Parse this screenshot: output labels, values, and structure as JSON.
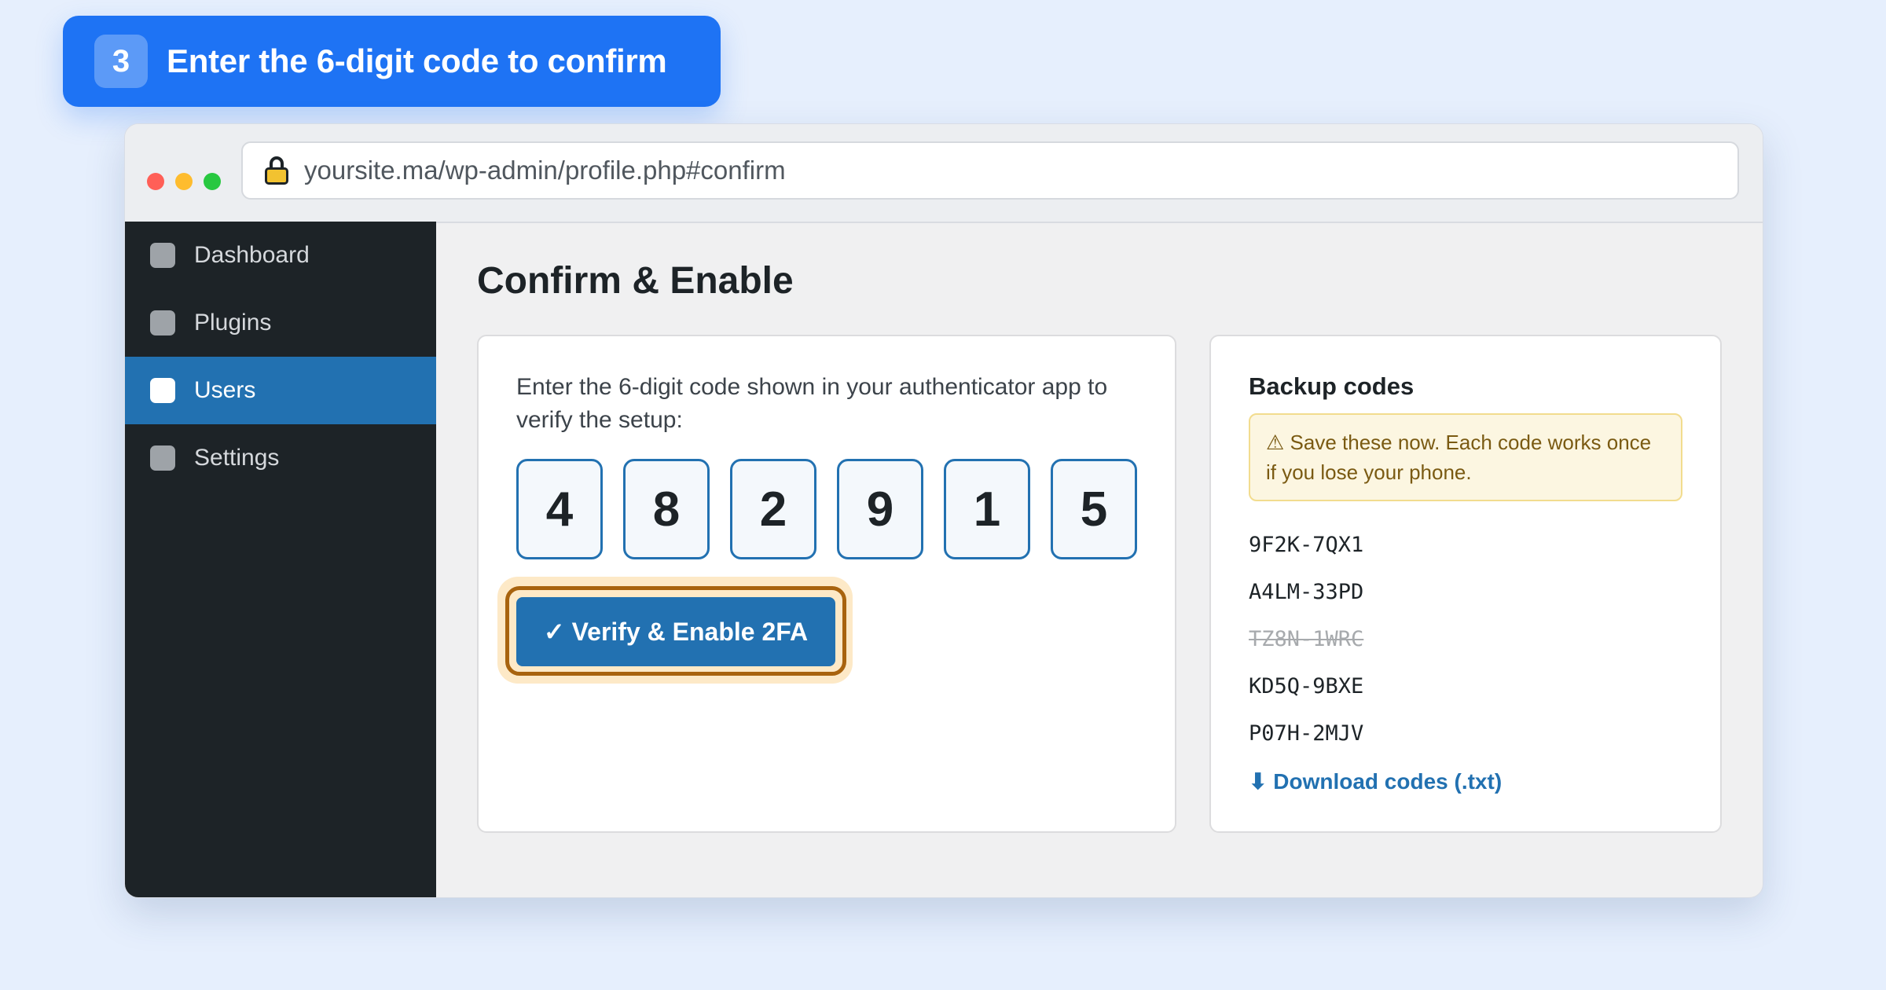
{
  "step": {
    "number": "3",
    "title": "Enter the 6-digit code to confirm"
  },
  "browser": {
    "url": "yoursite.ma/wp-admin/profile.php#confirm"
  },
  "sidebar": {
    "items": [
      {
        "label": "Dashboard",
        "active": false
      },
      {
        "label": "Plugins",
        "active": false
      },
      {
        "label": "Users",
        "active": true
      },
      {
        "label": "Settings",
        "active": false
      }
    ]
  },
  "main": {
    "title": "Confirm & Enable",
    "instruction": "Enter the 6-digit code shown in your authenticator app to verify the setup:",
    "digits": [
      "4",
      "8",
      "2",
      "9",
      "1",
      "5"
    ],
    "verify_label": "✓ Verify & Enable 2FA"
  },
  "backup": {
    "title": "Backup codes",
    "warning": "⚠ Save these now. Each code works once if you lose your phone.",
    "codes": [
      {
        "code": "9F2K-7QX1",
        "used": false
      },
      {
        "code": "A4LM-33PD",
        "used": false
      },
      {
        "code": "TZ8N-1WRC",
        "used": true
      },
      {
        "code": "KD5Q-9BXE",
        "used": false
      },
      {
        "code": "P07H-2MJV",
        "used": false
      }
    ],
    "download_label": "⬇ Download codes (.txt)"
  },
  "colors": {
    "accent": "#2271b1",
    "banner": "#1e73f4",
    "sidebar": "#1d2327",
    "highlight": "#a8630e"
  }
}
